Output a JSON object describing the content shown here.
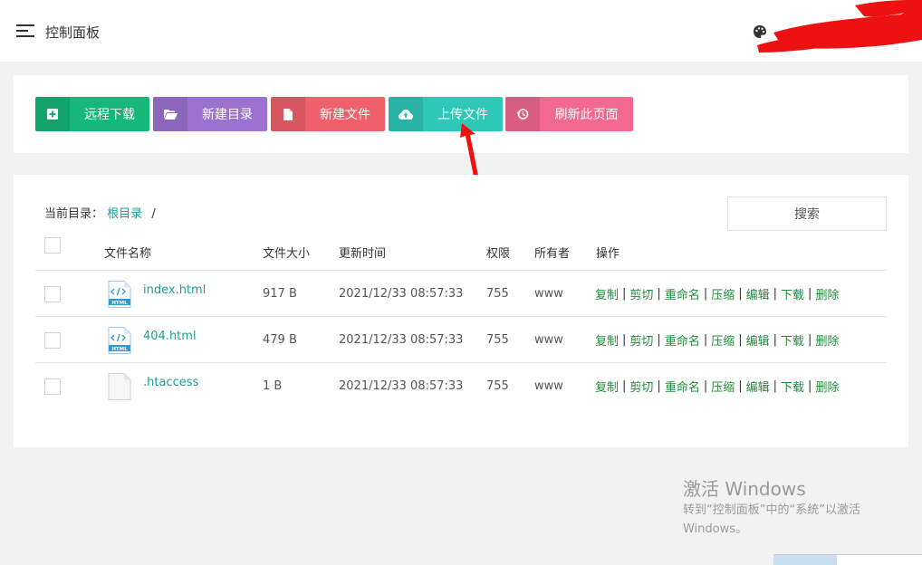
{
  "header": {
    "title": "控制面板",
    "menu_icon": "hamburger-menu-icon",
    "theme_icon": "palette-icon"
  },
  "toolbar": {
    "buttons": [
      {
        "label": "远程下载",
        "icon": "plus-square-icon",
        "color": "#16b777"
      },
      {
        "label": "新建目录",
        "icon": "folder-open-icon",
        "color": "#9b72d0"
      },
      {
        "label": "新建文件",
        "icon": "file-icon",
        "color": "#f0606a"
      },
      {
        "label": "上传文件",
        "icon": "cloud-upload-icon",
        "color": "#2ec7b8"
      },
      {
        "label": "刷新此页面",
        "icon": "history-icon",
        "color": "#f2688f"
      }
    ]
  },
  "browser": {
    "cwd_label": "当前目录：",
    "cwd_link": "根目录",
    "cwd_sep": "/",
    "search_label": "搜索",
    "columns": [
      "文件名称",
      "文件大小",
      "更新时间",
      "权限",
      "所有者",
      "操作"
    ],
    "rows": [
      {
        "name": "index.html",
        "icon": "html-file-icon",
        "size": "917 B",
        "mtime": "2021/12/33 08:57:33",
        "perm": "755",
        "owner": "www"
      },
      {
        "name": "404.html",
        "icon": "html-file-icon",
        "size": "479 B",
        "mtime": "2021/12/33 08:57:33",
        "perm": "755",
        "owner": "www"
      },
      {
        "name": ".htaccess",
        "icon": "blank-file-icon",
        "size": "1 B",
        "mtime": "2021/12/33 08:57:33",
        "perm": "755",
        "owner": "www"
      }
    ],
    "actions": [
      "复制",
      "剪切",
      "重命名",
      "压缩",
      "编辑",
      "下载",
      "删除"
    ],
    "action_sep": "|"
  },
  "watermark": {
    "title": "激活 Windows",
    "line1": "转到“控制面板”中的“系统”以激活",
    "line2": "Windows。"
  },
  "colors": {
    "link": "#1aa094",
    "action": "#1f8c3a",
    "annotation_arrow": "#ee1111"
  }
}
